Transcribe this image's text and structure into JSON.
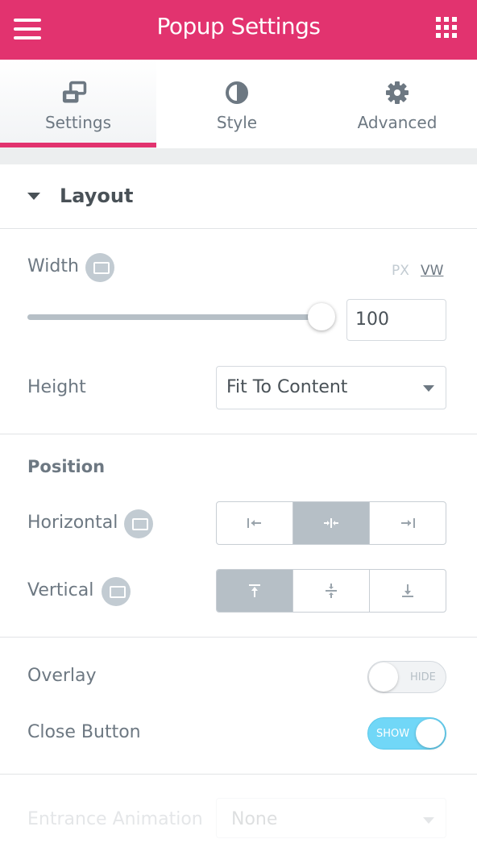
{
  "header": {
    "title": "Popup Settings"
  },
  "tabs": [
    {
      "label": "Settings",
      "icon": "settings-icon",
      "active": true
    },
    {
      "label": "Style",
      "icon": "contrast-icon",
      "active": false
    },
    {
      "label": "Advanced",
      "icon": "gear-icon",
      "active": false
    }
  ],
  "section": {
    "title": "Layout"
  },
  "width": {
    "label": "Width",
    "units": [
      "PX",
      "VW"
    ],
    "selected_unit": "VW",
    "value": "100",
    "slider_fraction": 1.0
  },
  "height": {
    "label": "Height",
    "value": "Fit To Content"
  },
  "position": {
    "title": "Position",
    "horizontal": {
      "label": "Horizontal",
      "options": [
        "align-left-icon",
        "align-center-icon",
        "align-right-icon"
      ],
      "selected": 1
    },
    "vertical": {
      "label": "Vertical",
      "options": [
        "align-top-icon",
        "align-middle-icon",
        "align-bottom-icon"
      ],
      "selected": 0
    }
  },
  "overlay": {
    "label": "Overlay",
    "state": "HIDE"
  },
  "close_button": {
    "label": "Close Button",
    "state": "SHOW"
  },
  "entrance_animation": {
    "label": "Entrance Animation",
    "value": "None"
  },
  "colors": {
    "accent": "#e2336f",
    "switch_on": "#71d7f7",
    "choice_selected": "#b6bfc6"
  }
}
